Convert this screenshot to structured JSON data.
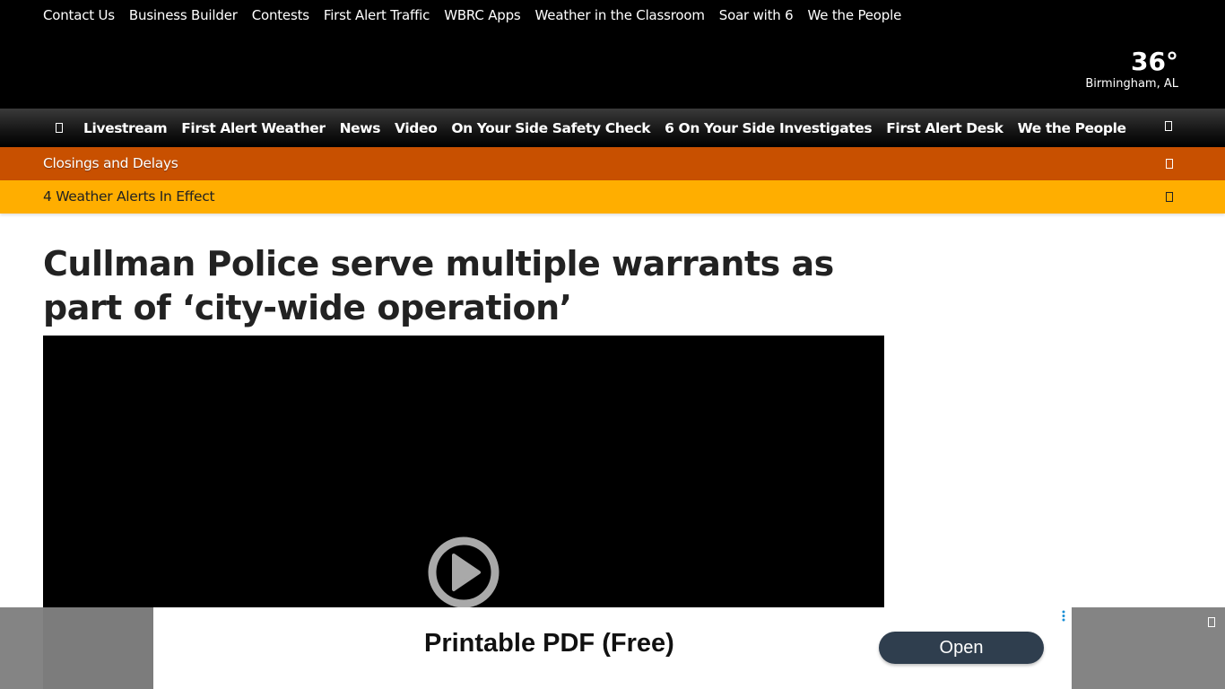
{
  "utility_nav": {
    "links": [
      "Contact Us",
      "Business Builder",
      "Contests",
      "First Alert Traffic",
      "WBRC Apps",
      "Weather in the Classroom",
      "Soar with 6",
      "We the People"
    ]
  },
  "weather": {
    "temperature": "36°",
    "location": "Birmingham, AL"
  },
  "main_nav": {
    "menu_icon": "menu-icon",
    "links": [
      "Livestream",
      "First Alert Weather",
      "News",
      "Video",
      "On Your Side Safety Check",
      "6 On Your Side Investigates",
      "First Alert Desk",
      "We the People"
    ],
    "search_icon": "search-icon"
  },
  "closings": {
    "label": "Closings and Delays",
    "color": "#c85000"
  },
  "alerts": {
    "label": "4 Weather Alerts In Effect",
    "color": "#ffae00"
  },
  "article": {
    "headline": "Cullman Police serve multiple warrants as part of ‘city-wide operation’"
  },
  "video": {
    "play_icon": "play-icon"
  },
  "ad": {
    "title": "Printable PDF (Free)",
    "button_label": "Open",
    "close_icon": "close-icon"
  }
}
